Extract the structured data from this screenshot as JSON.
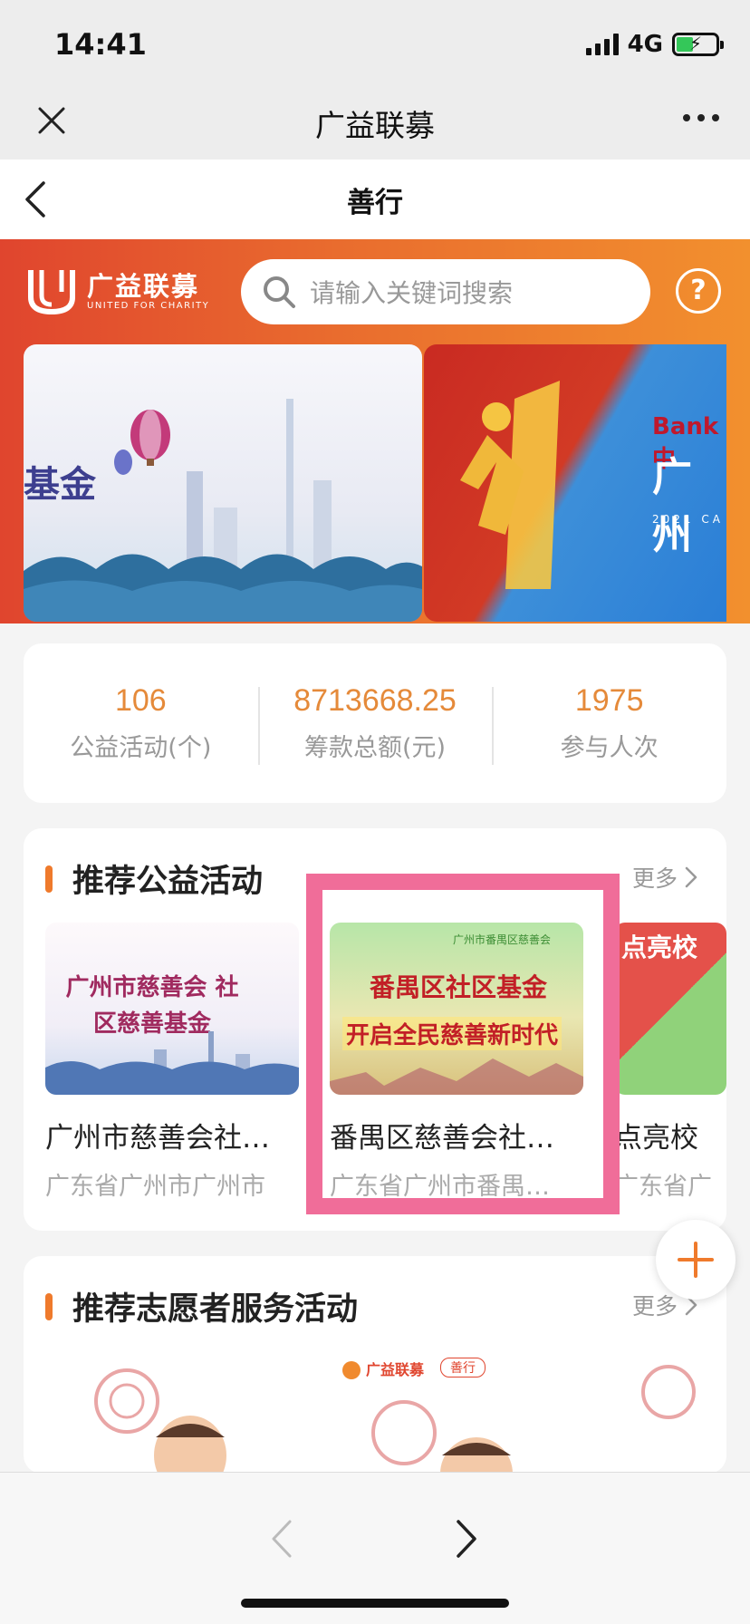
{
  "status_bar": {
    "time": "14:41",
    "network": "4G"
  },
  "mini_program": {
    "title": "广益联募"
  },
  "page": {
    "title": "善行"
  },
  "header": {
    "logo_cn": "广益联募",
    "logo_en": "UNITED FOR CHARITY",
    "search_placeholder": "请输入关键词搜索",
    "help_icon": "?"
  },
  "banners": [
    {
      "visible_text": "基金"
    },
    {
      "visible_text_1": "Bank 中",
      "visible_text_2": "广州",
      "visible_text_3": "2021 CA"
    }
  ],
  "stats": [
    {
      "value": "106",
      "label": "公益活动(个)"
    },
    {
      "value": "8713668.25",
      "label": "筹款总额(元)"
    },
    {
      "value": "1975",
      "label": "参与人次"
    }
  ],
  "recommended_activities": {
    "title": "推荐公益活动",
    "more": "更多",
    "items": [
      {
        "thumb_text": "广州市慈善会 社区慈善基金",
        "name": "广州市慈善会社…",
        "location": "广东省广州市广州市"
      },
      {
        "thumb_badge": "广州市番禺区慈善会",
        "thumb_text_1": "番禺区社区基金",
        "thumb_text_2": "开启全民慈善新时代",
        "name": "番禺区慈善会社…",
        "location": "广东省广州市番禺…"
      },
      {
        "thumb_text": "点亮校",
        "name": "点亮校",
        "location": "广东省广"
      }
    ]
  },
  "volunteer_activities": {
    "title": "推荐志愿者服务活动",
    "more": "更多",
    "second_card_logo": "广益联募",
    "second_card_tag": "善行"
  },
  "colors": {
    "accent_orange": "#e58a3a",
    "section_bar": "#ef7a2c",
    "highlight_pink": "#f06d99"
  }
}
